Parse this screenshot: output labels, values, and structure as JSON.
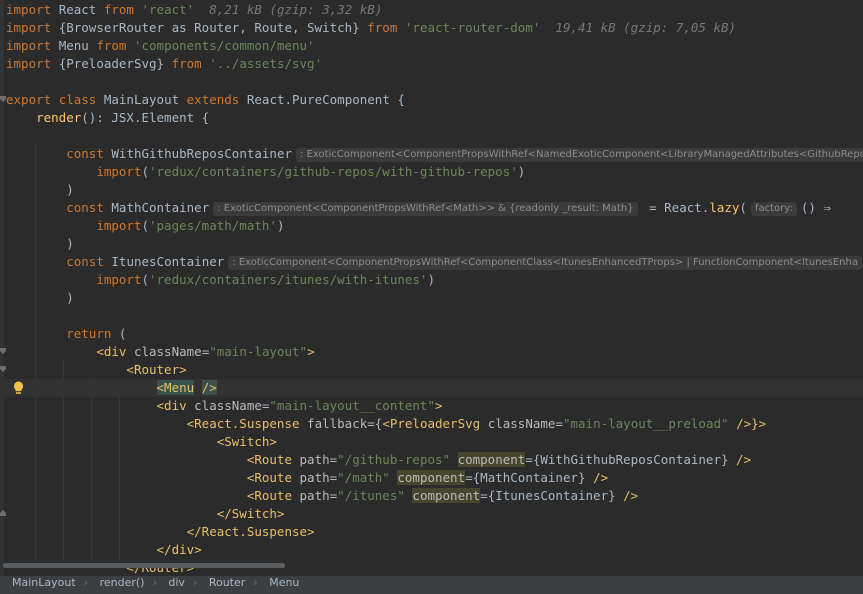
{
  "editor": {
    "imports": {
      "line1": {
        "kw": "import",
        "name": "React",
        "from": "from",
        "src": "'react'",
        "size": "8,21 kB (gzip: 3,32 kB)"
      },
      "line2": {
        "kw": "import",
        "name": "{BrowserRouter as Router, Route, Switch}",
        "from": "from",
        "src": "'react-router-dom'",
        "size": "19,41 kB (gzip: 7,05 kB)"
      },
      "line3": {
        "kw": "import",
        "name": "Menu",
        "from": "from",
        "src": "'components/common/menu'"
      },
      "line4": {
        "kw": "import",
        "name": "{PreloaderSvg}",
        "from": "from",
        "src": "'../assets/svg'"
      }
    },
    "class_decl": {
      "export": "export",
      "class": "class",
      "name": "MainLayout",
      "extends": "extends",
      "base": "React.PureComponent {"
    },
    "render_decl": {
      "fn": "render",
      "sig": "(): JSX.Element {"
    },
    "github": {
      "const": "const",
      "name": "WithGithubReposContainer",
      "hint": ": ExoticComponent<ComponentPropsWithRef<NamedExoticComponent<LibraryManagedAttributes<GithubRepos",
      "import_kw": "import",
      "path": "'redux/containers/github-repos/with-github-repos'"
    },
    "math": {
      "const": "const",
      "name": "MathContainer",
      "hint": ": ExoticComponent<ComponentPropsWithRef<Math>> & {readonly _result: Math}",
      "eq": "= React.",
      "lazy": "lazy",
      "paren": "(",
      "factory_hint": "factory:",
      "arrow": "() ⇒",
      "import_kw": "import",
      "path": "'pages/math/math'"
    },
    "itunes": {
      "const": "const",
      "name": "ItunesContainer",
      "hint": ": ExoticComponent<ComponentPropsWithRef<ComponentClass<ItunesEnhancedTProps> | FunctionComponent<ItunesEnha",
      "import_kw": "import",
      "path": "'redux/containers/itunes/with-itunes'"
    },
    "close_paren": ")",
    "return_kw": "return",
    "return_paren": "(",
    "jsx": {
      "div_open": "<div",
      "classname_attr": "className",
      "eq": "=",
      "main_layout": "\"main-layout\"",
      "gt": ">",
      "router_open": "<Router>",
      "menu_open": "<Menu",
      "self_close": "/>",
      "content_class": "\"main-layout__content\"",
      "suspense_open": "<React.Suspense",
      "fallback_attr": "fallback",
      "fallback_open": "={",
      "preloader": "<PreloaderSvg",
      "preload_class": "\"main-layout__preload\"",
      "fallback_close": "/>}>",
      "switch_open": "<Switch>",
      "route": "<Route",
      "path_attr": "path",
      "route1_path": "\"/github-repos\"",
      "route1_comp": "{WithGithubReposContainer}",
      "route2_path": "\"/math\"",
      "route2_comp": "{MathContainer}",
      "route3_path": "\"/itunes\"",
      "route3_comp": "{ItunesContainer}",
      "component_attr": "component",
      "switch_close": "</Switch>",
      "suspense_close": "</React.Suspense>",
      "div_close": "</div>",
      "router_close": "</Router>"
    }
  },
  "breadcrumb": [
    "MainLayout",
    "render()",
    "div",
    "Router",
    "Menu"
  ]
}
